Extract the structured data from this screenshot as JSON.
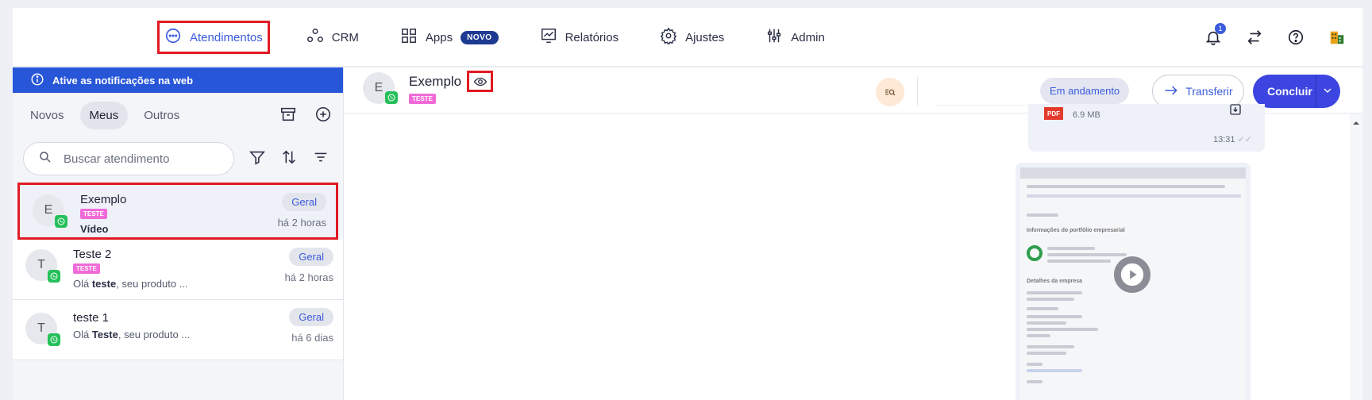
{
  "nav": {
    "items": [
      {
        "label": "Atendimentos",
        "icon": "chat-bubble-icon"
      },
      {
        "label": "CRM",
        "icon": "nodes-icon"
      },
      {
        "label": "Apps",
        "icon": "grid-icon",
        "badge": "NOVO"
      },
      {
        "label": "Relatórios",
        "icon": "chart-icon"
      },
      {
        "label": "Ajustes",
        "icon": "gear-icon"
      },
      {
        "label": "Admin",
        "icon": "sliders-icon"
      }
    ],
    "notification_count": "1"
  },
  "sidebar": {
    "notify_banner": "Ative as notificações na web",
    "tabs": [
      "Novos",
      "Meus",
      "Outros"
    ],
    "search_placeholder": "Buscar atendimento",
    "conversations": [
      {
        "initial": "E",
        "name": "Exemplo",
        "tag": "TESTE",
        "message_bold": "Vídeo",
        "message": "",
        "queue": "Geral",
        "time": "há 2 horas"
      },
      {
        "initial": "T",
        "name": "Teste 2",
        "tag": "TESTE",
        "message_pre": "Olá ",
        "message_bold": "teste",
        "message": ", seu produto ...",
        "queue": "Geral",
        "time": "há 2 horas"
      },
      {
        "initial": "T",
        "name": "teste 1",
        "message_pre": "Olá ",
        "message_bold": "Teste",
        "message": ", seu produto ...",
        "queue": "Geral",
        "time": "há 6 dias"
      }
    ]
  },
  "chat": {
    "contact_initial": "E",
    "contact_name": "Exemplo",
    "contact_tag": "TESTE",
    "status": "Em andamento",
    "transfer_label": "Transferir",
    "conclude_label": "Concluir",
    "file_message": {
      "type_label": "PDF",
      "size": "6.9 MB",
      "time": "13:31"
    },
    "video_thumbnail": {
      "heading": "Informações do portfólio empresarial",
      "section": "Detalhes da empresa"
    }
  },
  "colors": {
    "accent": "#3b5bdb",
    "primary_button": "#3c45e0",
    "banner": "#2756d9",
    "highlight": "#e01b24",
    "whatsapp": "#25c05a",
    "tag": "#f06bd8"
  }
}
